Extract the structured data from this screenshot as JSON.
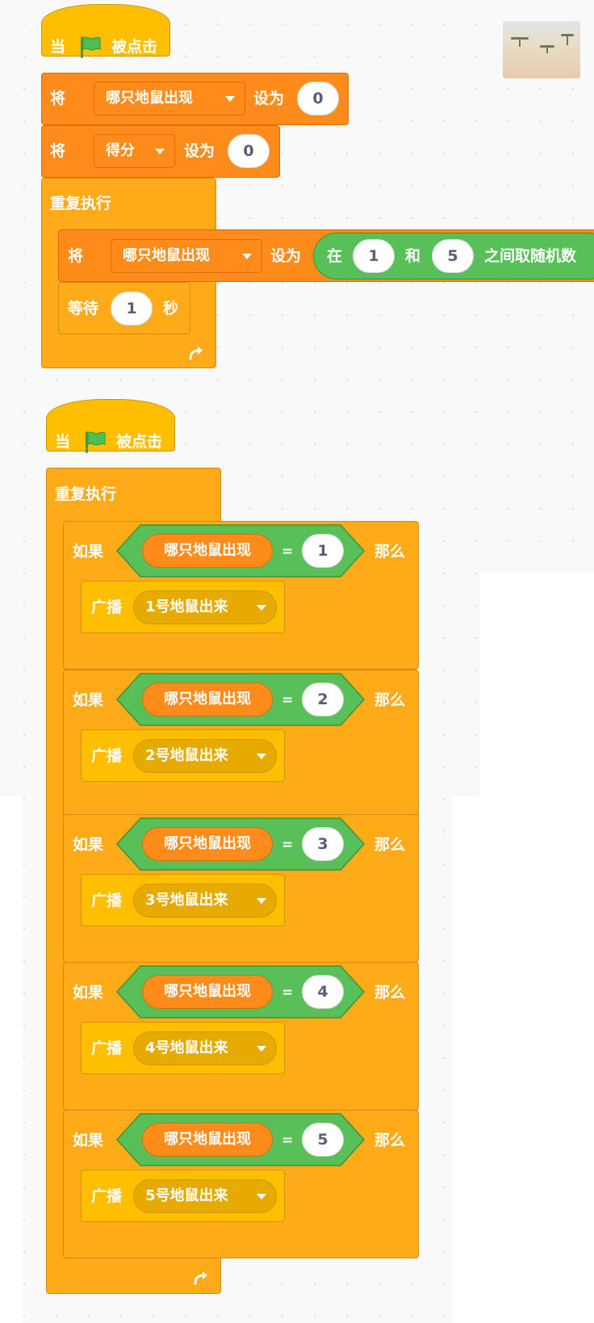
{
  "script1": {
    "hat": {
      "when": "当",
      "flag_icon": "green-flag-icon",
      "clicked": "被点击"
    },
    "set1": {
      "label": "将",
      "variable": "哪只地鼠出现",
      "to": "设为",
      "value": "0"
    },
    "set2": {
      "label": "将",
      "variable": "得分",
      "to": "设为",
      "value": "0"
    },
    "forever": {
      "label": "重复执行",
      "loop_icon": "loop-arrow-icon"
    },
    "set_random": {
      "label": "将",
      "variable": "哪只地鼠出现",
      "to": "设为",
      "pick": "在",
      "from": "1",
      "and": "和",
      "to_val": "5",
      "suffix": "之间取随机数"
    },
    "wait": {
      "label": "等待",
      "value": "1",
      "unit": "秒"
    }
  },
  "script2": {
    "hat": {
      "when": "当",
      "flag_icon": "green-flag-icon",
      "clicked": "被点击"
    },
    "forever": {
      "label": "重复执行",
      "loop_icon": "loop-arrow-icon"
    },
    "ifs": [
      {
        "if": "如果",
        "reporter": "哪只地鼠出现",
        "op": "=",
        "value": "1",
        "then": "那么",
        "broadcast": "广播",
        "message": "1号地鼠出来"
      },
      {
        "if": "如果",
        "reporter": "哪只地鼠出现",
        "op": "=",
        "value": "2",
        "then": "那么",
        "broadcast": "广播",
        "message": "2号地鼠出来"
      },
      {
        "if": "如果",
        "reporter": "哪只地鼠出现",
        "op": "=",
        "value": "3",
        "then": "那么",
        "broadcast": "广播",
        "message": "3号地鼠出来"
      },
      {
        "if": "如果",
        "reporter": "哪只地鼠出现",
        "op": "=",
        "value": "4",
        "then": "那么",
        "broadcast": "广播",
        "message": "4号地鼠出来"
      },
      {
        "if": "如果",
        "reporter": "哪只地鼠出现",
        "op": "=",
        "value": "5",
        "then": "那么",
        "broadcast": "广播",
        "message": "5号地鼠出来"
      }
    ]
  },
  "colors": {
    "events": "#ffbf00",
    "control": "#ffab19",
    "variables": "#ff8c1a",
    "operators": "#59c059",
    "flag": "#4cbf56"
  },
  "stage_thumbnail": "savanna-backdrop-thumbnail"
}
